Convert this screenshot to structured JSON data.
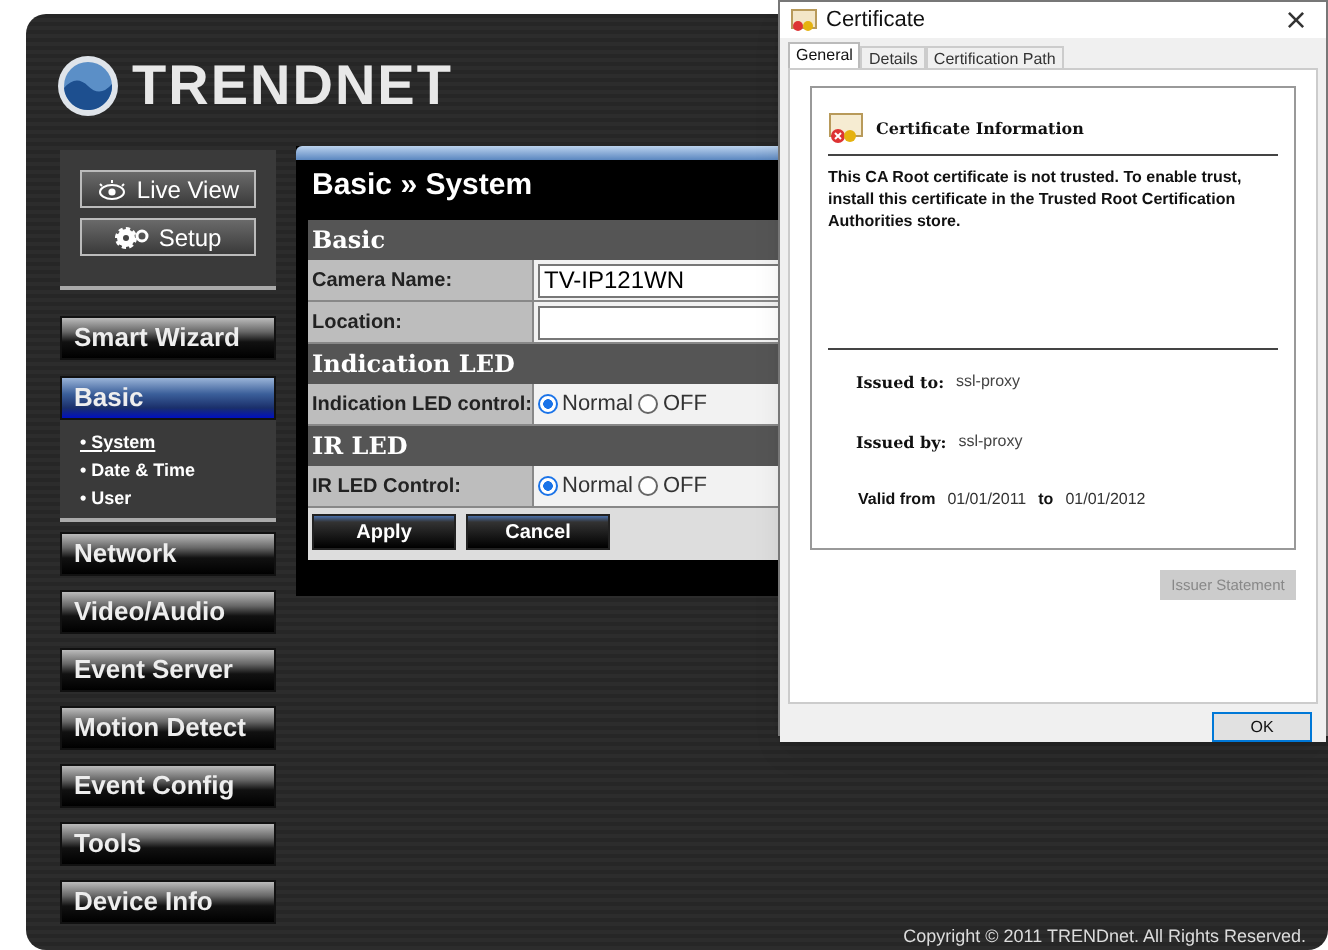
{
  "logo": {
    "text": "TRENDNET"
  },
  "top_buttons": [
    {
      "label": "Live View",
      "kind": "eye"
    },
    {
      "label": "Setup",
      "kind": "gear"
    }
  ],
  "menu": [
    {
      "label": "Smart Wizard",
      "selected": false
    },
    {
      "label": "Basic",
      "selected": true,
      "children": [
        {
          "label": "• System",
          "selected": true
        },
        {
          "label": "• Date & Time",
          "selected": false
        },
        {
          "label": "• User",
          "selected": false
        }
      ]
    },
    {
      "label": "Network",
      "selected": false
    },
    {
      "label": "Video/Audio",
      "selected": false
    },
    {
      "label": "Event Server",
      "selected": false
    },
    {
      "label": "Motion Detect",
      "selected": false
    },
    {
      "label": "Event Config",
      "selected": false
    },
    {
      "label": "Tools",
      "selected": false
    },
    {
      "label": "Device Info",
      "selected": false
    }
  ],
  "content": {
    "title": "Basic » System",
    "rows": [
      {
        "kind": "section",
        "label": "Basic"
      },
      {
        "kind": "text",
        "label": "Camera Name:",
        "value": "TV-IP121WN"
      },
      {
        "kind": "text",
        "label": "Location:"
      },
      {
        "kind": "section",
        "label": "Indication LED"
      },
      {
        "kind": "radio",
        "label": "Indication LED control:",
        "options": [
          {
            "label": "Normal",
            "selected": true
          },
          {
            "label": "OFF",
            "selected": false
          }
        ]
      },
      {
        "kind": "section",
        "label": "IR LED"
      },
      {
        "kind": "radio",
        "label": "IR LED Control:",
        "options": [
          {
            "label": "Normal",
            "selected": true
          },
          {
            "label": "OFF",
            "selected": false
          }
        ]
      }
    ],
    "buttons": [
      "Apply",
      "Cancel"
    ]
  },
  "footer": "Copyright © 2011 TRENDnet. All Rights Reserved.",
  "dialog": {
    "title": "Certificate",
    "close": "×",
    "tabs": [
      {
        "label": "General",
        "selected": true
      },
      {
        "label": "Details",
        "selected": false
      },
      {
        "label": "Certification Path",
        "selected": false
      }
    ],
    "heading": "Certificate Information",
    "message": "This CA Root certificate is not trusted. To enable trust, install this certificate in the Trusted Root Certification Authorities store.",
    "issued_to": {
      "label": "Issued to:",
      "value": "ssl-proxy"
    },
    "issued_by": {
      "label": "Issued by:",
      "value": "ssl-proxy"
    },
    "valid": {
      "from_label": "Valid from",
      "from": "01/01/2011",
      "to_label": "to",
      "to": "01/01/2012"
    },
    "issuer_button": {
      "label": "Issuer Statement",
      "disabled": true
    },
    "ok_button": "OK"
  }
}
